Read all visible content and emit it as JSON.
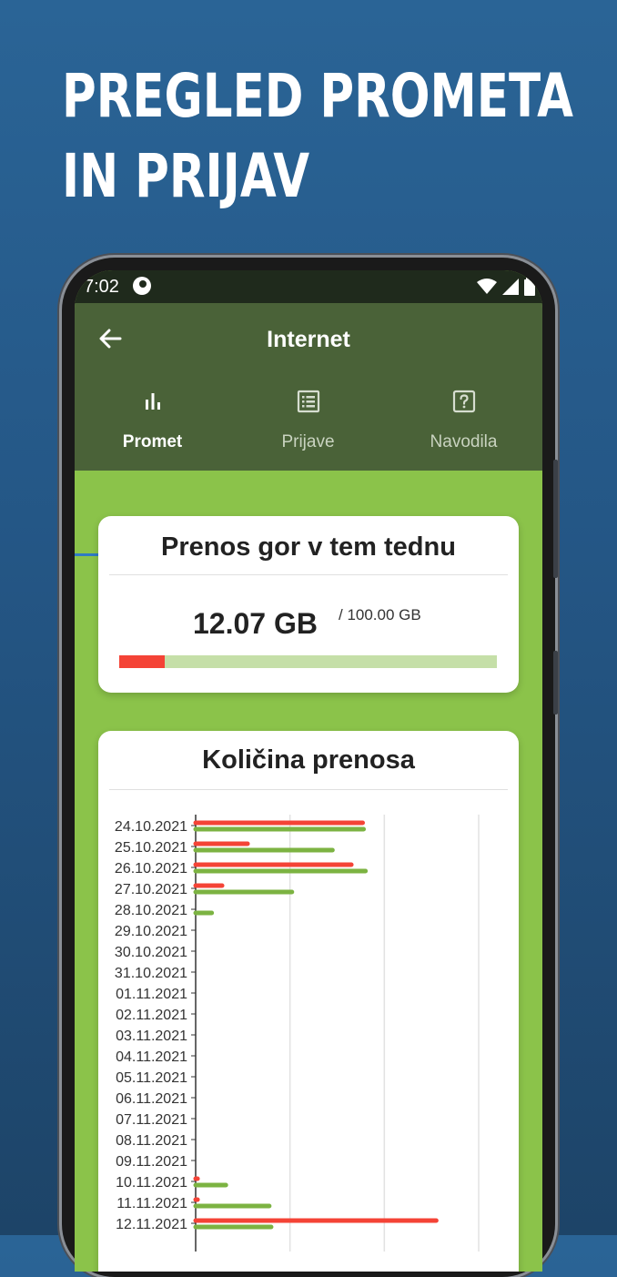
{
  "promo": {
    "line1": "PREGLED PROMETA",
    "line2": "IN PRIJAV"
  },
  "statusbar": {
    "time": "7:02",
    "icons": [
      "app-notification-icon",
      "wifi-icon",
      "signal-icon",
      "battery-icon"
    ]
  },
  "appbar": {
    "title": "Internet",
    "back_icon": "arrow-left-icon"
  },
  "tabs": [
    {
      "label": "Promet",
      "icon": "bar-chart-icon",
      "active": true
    },
    {
      "label": "Prijave",
      "icon": "list-icon",
      "active": false
    },
    {
      "label": "Navodila",
      "icon": "help-icon",
      "active": false
    }
  ],
  "upload_card": {
    "title": "Prenos gor v tem tednu",
    "used": "12.07 GB",
    "limit": "/ 100.00 GB",
    "used_fraction": 0.1207
  },
  "transfer_card": {
    "title": "Količina prenosa"
  },
  "colors": {
    "upload_series": "#f44336",
    "download_series": "#7cb342",
    "app_bar": "#4a6238",
    "screen_bg": "#8bc34a",
    "tab_indicator": "#2f7bc4"
  },
  "chart_data": {
    "type": "bar",
    "orientation": "horizontal",
    "categories": [
      "24.10.2021",
      "25.10.2021",
      "26.10.2021",
      "27.10.2021",
      "28.10.2021",
      "29.10.2021",
      "30.10.2021",
      "31.10.2021",
      "01.11.2021",
      "02.11.2021",
      "03.11.2021",
      "04.11.2021",
      "05.11.2021",
      "06.11.2021",
      "07.11.2021",
      "08.11.2021",
      "09.11.2021",
      "10.11.2021",
      "11.11.2021",
      "12.11.2021"
    ],
    "series": [
      {
        "color": "#f44336",
        "values": [
          1.77,
          0.55,
          1.65,
          0.28,
          0,
          0,
          0,
          0,
          0,
          0,
          0,
          0,
          0,
          0,
          0,
          0,
          0,
          0.02,
          0.02,
          2.55
        ]
      },
      {
        "color": "#7cb342",
        "values": [
          1.78,
          1.45,
          1.8,
          1.02,
          0.17,
          0,
          0,
          0,
          0,
          0,
          0,
          0,
          0,
          0,
          0,
          0,
          0,
          0.32,
          0.78,
          0.8
        ]
      }
    ],
    "xlim": [
      0,
      3
    ],
    "gridlines": [
      1,
      2,
      3
    ],
    "grid": true
  }
}
